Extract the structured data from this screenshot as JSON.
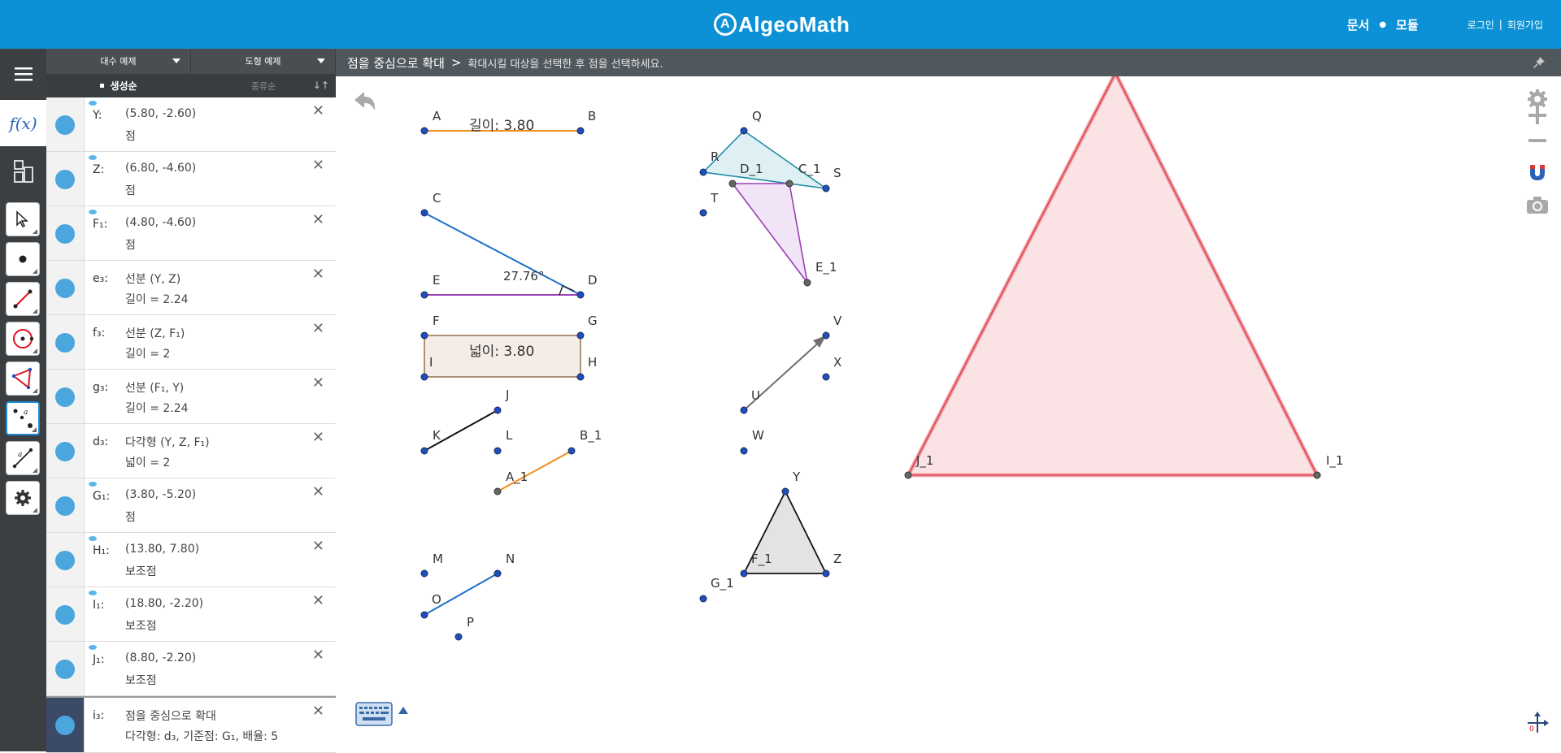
{
  "topbar": {
    "logo_text": "AlgeoMath",
    "nav": {
      "docs": "문서",
      "modules": "모듈",
      "login": "로그인",
      "signup": "회원가입",
      "separator": "|"
    }
  },
  "algebra_panel": {
    "tab_algebra_examples": "대수 예제",
    "tab_geometry_examples": "도형 예제",
    "sort_created": "생성순",
    "sort_type": "종류순",
    "rows": [
      {
        "name": "Y:",
        "line1": "(5.80, -2.60)",
        "line2": "점",
        "eye": true
      },
      {
        "name": "Z:",
        "line1": "(6.80, -4.60)",
        "line2": "점",
        "eye": true
      },
      {
        "name": "F₁:",
        "line1": "(4.80, -4.60)",
        "line2": "점",
        "eye": true
      },
      {
        "name": "e₃:",
        "line1": "선분 (Y, Z)",
        "line2": "길이 = 2.24",
        "eye": false
      },
      {
        "name": "f₃:",
        "line1": "선분 (Z, F₁)",
        "line2": "길이 = 2",
        "eye": false
      },
      {
        "name": "g₃:",
        "line1": "선분 (F₁, Y)",
        "line2": "길이 = 2.24",
        "eye": false
      },
      {
        "name": "d₃:",
        "line1": "다각형 (Y, Z, F₁)",
        "line2": "넓이 = 2",
        "eye": false
      },
      {
        "name": "G₁:",
        "line1": "(3.80, -5.20)",
        "line2": "점",
        "eye": true
      },
      {
        "name": "H₁:",
        "line1": "(13.80, 7.80)",
        "line2": "보조점",
        "eye": true
      },
      {
        "name": "I₁:",
        "line1": "(18.80, -2.20)",
        "line2": "보조점",
        "eye": true
      },
      {
        "name": "J₁:",
        "line1": "(8.80, -2.20)",
        "line2": "보조점",
        "eye": true
      },
      {
        "name": "i₃:",
        "line1": "점을 중심으로 확대",
        "line2": "다각형: d₃, 기준점: G₁, 배율: 5",
        "eye": false
      }
    ]
  },
  "instruction_bar": {
    "tool_name": "점을 중심으로 확대",
    "chevron": ">",
    "hint": "확대시킬 대상을 선택한 후 점을 선택하세요."
  },
  "canvas": {
    "labels": {
      "A": "A",
      "B": "B",
      "C": "C",
      "D": "D",
      "E": "E",
      "F": "F",
      "G": "G",
      "H": "H",
      "I": "I",
      "J": "J",
      "K": "K",
      "L": "L",
      "M": "M",
      "N": "N",
      "O": "O",
      "P": "P",
      "Q": "Q",
      "R": "R",
      "S": "S",
      "T": "T",
      "U": "U",
      "V": "V",
      "W": "W",
      "X": "X",
      "Y": "Y",
      "Z": "Z",
      "A_1": "A_1",
      "B_1": "B_1",
      "C_1": "C_1",
      "D_1": "D_1",
      "E_1": "E_1",
      "F_1": "F_1",
      "G_1": "G_1",
      "I_1": "I_1",
      "J_1": "J_1"
    },
    "length_AB": "길이: 3.80",
    "angle_CDE": "27.76°",
    "area_FGHI": "넓이: 3.80"
  },
  "colors": {
    "topbar": "#0d91d6",
    "point": "#1f4fbf",
    "segment_orange": "#f28c1b",
    "segment_blue": "#1c6fc9",
    "segment_purple": "#9b3fb5",
    "triangle_pink_fill": "#fbe3e5",
    "triangle_pink_edge": "#e0444f"
  },
  "icons": {
    "menu": "menu-icon",
    "fx": "function-icon",
    "undo": "undo-icon",
    "settings": "gear-icon",
    "zoom_in": "plus-icon",
    "zoom_out": "minus-icon",
    "magnet": "magnet-icon",
    "camera": "camera-icon",
    "keyboard": "keyboard-icon",
    "axes": "axes-icon",
    "pin": "pin-icon"
  }
}
